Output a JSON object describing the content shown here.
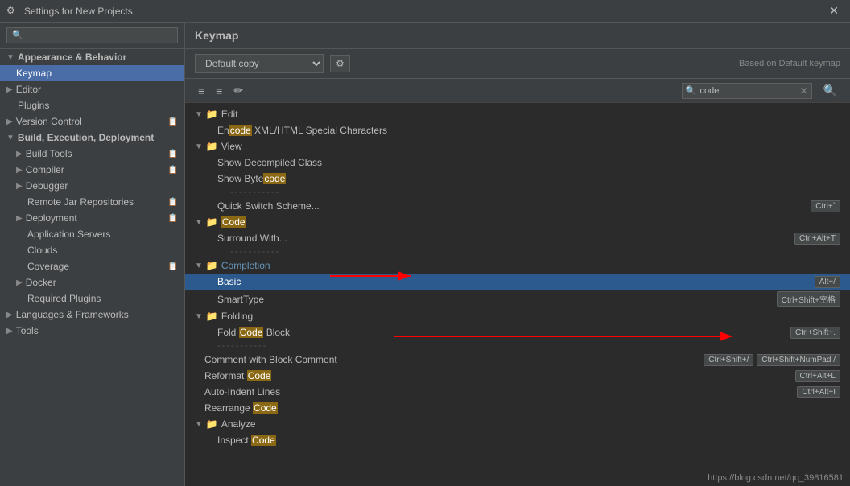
{
  "titleBar": {
    "icon": "⚙",
    "title": "Settings for New Projects",
    "closeLabel": "✕"
  },
  "sidebar": {
    "searchPlaceholder": "🔍",
    "items": [
      {
        "id": "appearance",
        "label": "Appearance & Behavior",
        "indent": 0,
        "type": "section",
        "expanded": true,
        "arrow": "▼"
      },
      {
        "id": "keymap",
        "label": "Keymap",
        "indent": 1,
        "type": "item",
        "selected": true
      },
      {
        "id": "editor",
        "label": "Editor",
        "indent": 0,
        "type": "section",
        "expanded": false,
        "arrow": "▶"
      },
      {
        "id": "plugins",
        "label": "Plugins",
        "indent": 0,
        "type": "item"
      },
      {
        "id": "version-control",
        "label": "Version Control",
        "indent": 0,
        "type": "section",
        "expanded": false,
        "arrow": "▶",
        "hasCopy": true
      },
      {
        "id": "build-execution",
        "label": "Build, Execution, Deployment",
        "indent": 0,
        "type": "section",
        "expanded": true,
        "arrow": "▼"
      },
      {
        "id": "build-tools",
        "label": "Build Tools",
        "indent": 1,
        "type": "section",
        "expanded": false,
        "arrow": "▶",
        "hasCopy": true
      },
      {
        "id": "compiler",
        "label": "Compiler",
        "indent": 1,
        "type": "section",
        "expanded": false,
        "arrow": "▶",
        "hasCopy": true
      },
      {
        "id": "debugger",
        "label": "Debugger",
        "indent": 1,
        "type": "section",
        "expanded": false,
        "arrow": "▶"
      },
      {
        "id": "remote-jar",
        "label": "Remote Jar Repositories",
        "indent": 1,
        "type": "item",
        "hasCopy": true
      },
      {
        "id": "deployment",
        "label": "Deployment",
        "indent": 1,
        "type": "section",
        "expanded": false,
        "arrow": "▶",
        "hasCopy": true
      },
      {
        "id": "application-servers",
        "label": "Application Servers",
        "indent": 1,
        "type": "item"
      },
      {
        "id": "clouds",
        "label": "Clouds",
        "indent": 1,
        "type": "item"
      },
      {
        "id": "coverage",
        "label": "Coverage",
        "indent": 1,
        "type": "item",
        "hasCopy": true
      },
      {
        "id": "docker",
        "label": "Docker",
        "indent": 1,
        "type": "section",
        "expanded": false,
        "arrow": "▶"
      },
      {
        "id": "required-plugins",
        "label": "Required Plugins",
        "indent": 1,
        "type": "item"
      },
      {
        "id": "languages",
        "label": "Languages & Frameworks",
        "indent": 0,
        "type": "section",
        "expanded": false,
        "arrow": "▶"
      },
      {
        "id": "tools",
        "label": "Tools",
        "indent": 0,
        "type": "section",
        "expanded": false,
        "arrow": "▶"
      }
    ]
  },
  "content": {
    "title": "Keymap",
    "selectValue": "Default copy",
    "basedLabel": "Based on Default keymap",
    "searchValue": "code",
    "rows": [
      {
        "id": "edit-section",
        "type": "folder-section",
        "indent": 0,
        "arrow": "▼",
        "label": "Edit"
      },
      {
        "id": "encode-xml",
        "type": "item",
        "indent": 2,
        "label_before": "En",
        "highlight": "code",
        "label_after": " XML/HTML Special Characters",
        "shortcuts": []
      },
      {
        "id": "view-section",
        "type": "folder-section",
        "indent": 0,
        "arrow": "▼",
        "label": "View"
      },
      {
        "id": "show-decompiled",
        "type": "item",
        "indent": 2,
        "label_before": "Show Decompiled Class",
        "highlight": "",
        "label_after": "",
        "shortcuts": []
      },
      {
        "id": "show-bytecode",
        "type": "item",
        "indent": 2,
        "label_before": "Show Byte",
        "highlight": "code",
        "label_after": "",
        "shortcuts": []
      },
      {
        "id": "separator1",
        "type": "separator"
      },
      {
        "id": "quick-switch",
        "type": "item",
        "indent": 2,
        "label_before": "Quick Switch Scheme...",
        "highlight": "",
        "label_after": "",
        "shortcuts": [
          "Ctrl+`"
        ]
      },
      {
        "id": "code-section",
        "type": "folder-section",
        "indent": 0,
        "arrow": "▼",
        "label_before": "",
        "highlight": "Code",
        "label_after": "",
        "color": "blue"
      },
      {
        "id": "surround-with",
        "type": "item",
        "indent": 2,
        "label_before": "Surround With...",
        "highlight": "",
        "label_after": "",
        "shortcuts": [
          "Ctrl+Alt+T"
        ]
      },
      {
        "id": "separator2",
        "type": "separator"
      },
      {
        "id": "completion-section",
        "type": "folder-section",
        "indent": 0,
        "arrow": "▼",
        "label": "Completion",
        "color": "blue"
      },
      {
        "id": "basic",
        "type": "item",
        "indent": 2,
        "label_before": "Basic",
        "highlight": "",
        "label_after": "",
        "shortcuts": [
          "Alt+/"
        ],
        "selected": true
      },
      {
        "id": "smart-type",
        "type": "item",
        "indent": 2,
        "label_before": "SmartType",
        "highlight": "",
        "label_after": "",
        "shortcuts": [
          "Ctrl+Shift+空格"
        ]
      },
      {
        "id": "folding-section",
        "type": "folder-section",
        "indent": 0,
        "arrow": "▼",
        "label": "Folding"
      },
      {
        "id": "fold-code",
        "type": "item",
        "indent": 2,
        "label_before": "Fold ",
        "highlight": "Code",
        "label_after": " Block",
        "shortcuts": [
          "Ctrl+Shift+."
        ]
      },
      {
        "id": "separator3",
        "type": "separator"
      },
      {
        "id": "comment-block",
        "type": "item",
        "indent": 1,
        "label_before": "Comment with Block Comment",
        "highlight": "",
        "label_after": "",
        "shortcuts": [
          "Ctrl+Shift+/",
          "Ctrl+Shift+NumPad /"
        ]
      },
      {
        "id": "reformat-code",
        "type": "item",
        "indent": 1,
        "label_before": "Reformat ",
        "highlight": "Code",
        "label_after": "",
        "shortcuts": [
          "Ctrl+Alt+L"
        ]
      },
      {
        "id": "auto-indent",
        "type": "item",
        "indent": 1,
        "label_before": "Auto-Indent Lines",
        "highlight": "",
        "label_after": "",
        "shortcuts": [
          "Ctrl+Alt+I"
        ]
      },
      {
        "id": "rearrange-code",
        "type": "item",
        "indent": 1,
        "label_before": "Rearrange ",
        "highlight": "Code",
        "label_after": "",
        "shortcuts": []
      },
      {
        "id": "analyze-section",
        "type": "folder-section",
        "indent": 0,
        "arrow": "▼",
        "label": "Analyze"
      },
      {
        "id": "inspect-code",
        "type": "item",
        "indent": 2,
        "label_before": "Inspect ",
        "highlight": "Code",
        "label_after": "",
        "shortcuts": []
      }
    ],
    "urlLabel": "https://blog.csdn.net/qq_39816581"
  }
}
